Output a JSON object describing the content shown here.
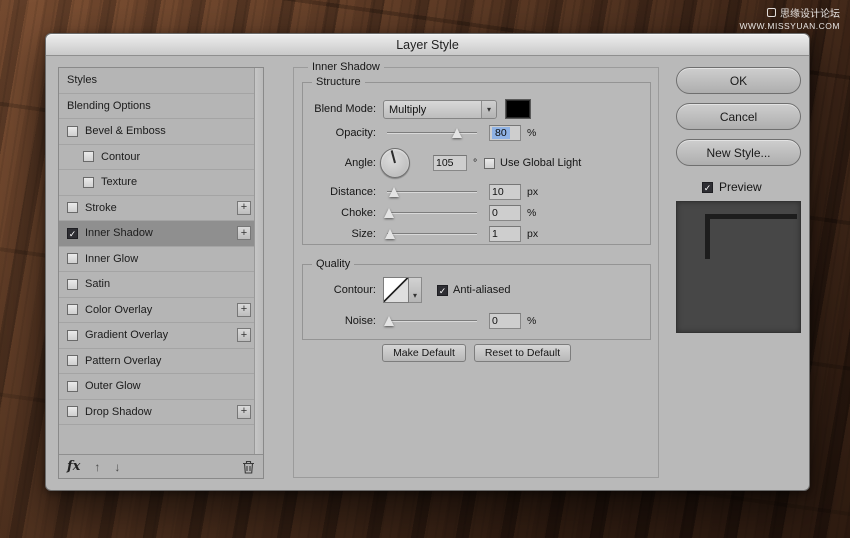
{
  "watermark": {
    "site_name": "思缘设计论坛",
    "site_url": "WWW.MISSYUAN.COM"
  },
  "dialog": {
    "title": "Layer Style"
  },
  "sidebar": {
    "items": [
      {
        "label": "Styles",
        "checkbox": false,
        "checked": false,
        "indent": false,
        "plus": false,
        "selected": false
      },
      {
        "label": "Blending Options",
        "checkbox": false,
        "checked": false,
        "indent": false,
        "plus": false,
        "selected": false
      },
      {
        "label": "Bevel & Emboss",
        "checkbox": true,
        "checked": false,
        "indent": false,
        "plus": false,
        "selected": false
      },
      {
        "label": "Contour",
        "checkbox": true,
        "checked": false,
        "indent": true,
        "plus": false,
        "selected": false
      },
      {
        "label": "Texture",
        "checkbox": true,
        "checked": false,
        "indent": true,
        "plus": false,
        "selected": false
      },
      {
        "label": "Stroke",
        "checkbox": true,
        "checked": false,
        "indent": false,
        "plus": true,
        "selected": false
      },
      {
        "label": "Inner Shadow",
        "checkbox": true,
        "checked": true,
        "indent": false,
        "plus": true,
        "selected": true
      },
      {
        "label": "Inner Glow",
        "checkbox": true,
        "checked": false,
        "indent": false,
        "plus": false,
        "selected": false
      },
      {
        "label": "Satin",
        "checkbox": true,
        "checked": false,
        "indent": false,
        "plus": false,
        "selected": false
      },
      {
        "label": "Color Overlay",
        "checkbox": true,
        "checked": false,
        "indent": false,
        "plus": true,
        "selected": false
      },
      {
        "label": "Gradient Overlay",
        "checkbox": true,
        "checked": false,
        "indent": false,
        "plus": true,
        "selected": false
      },
      {
        "label": "Pattern Overlay",
        "checkbox": true,
        "checked": false,
        "indent": false,
        "plus": false,
        "selected": false
      },
      {
        "label": "Outer Glow",
        "checkbox": true,
        "checked": false,
        "indent": false,
        "plus": false,
        "selected": false
      },
      {
        "label": "Drop Shadow",
        "checkbox": true,
        "checked": false,
        "indent": false,
        "plus": true,
        "selected": false
      }
    ],
    "footer": {
      "fx_label": "fx"
    }
  },
  "main": {
    "panel_title": "Inner Shadow",
    "structure": {
      "legend": "Structure",
      "blend_mode_label": "Blend Mode:",
      "blend_mode_value": "Multiply",
      "opacity_label": "Opacity:",
      "opacity_value": "80",
      "opacity_unit": "%",
      "angle_label": "Angle:",
      "angle_value": "105",
      "angle_unit": "°",
      "use_global_light_label": "Use Global Light",
      "distance_label": "Distance:",
      "distance_value": "10",
      "distance_unit": "px",
      "choke_label": "Choke:",
      "choke_value": "0",
      "choke_unit": "%",
      "size_label": "Size:",
      "size_value": "1",
      "size_unit": "px"
    },
    "quality": {
      "legend": "Quality",
      "contour_label": "Contour:",
      "anti_aliased_label": "Anti-aliased",
      "noise_label": "Noise:",
      "noise_value": "0",
      "noise_unit": "%"
    },
    "footer_buttons": {
      "make_default": "Make Default",
      "reset_to_default": "Reset to Default"
    }
  },
  "actions": {
    "ok": "OK",
    "cancel": "Cancel",
    "new_style": "New Style...",
    "preview_label": "Preview"
  },
  "sliders": {
    "opacity": {
      "thumb_pct": 78
    },
    "distance": {
      "thumb_pct": 8
    },
    "choke": {
      "thumb_pct": 2
    },
    "size": {
      "thumb_pct": 3
    },
    "noise": {
      "thumb_pct": 2
    }
  },
  "colors": {
    "blend_swatch": "#000000",
    "selection_highlight": "#8fb2e4"
  }
}
